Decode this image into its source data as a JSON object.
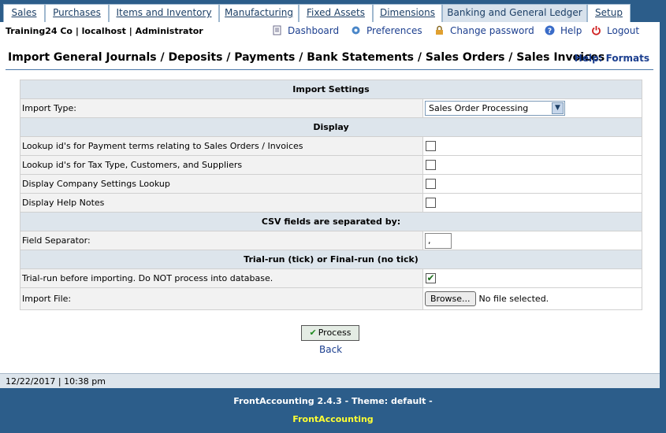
{
  "tabs": [
    {
      "label": "Sales",
      "active": false
    },
    {
      "label": "Purchases",
      "active": false
    },
    {
      "label": "Items and Inventory",
      "active": false
    },
    {
      "label": "Manufacturing",
      "active": false
    },
    {
      "label": "Fixed Assets",
      "active": false
    },
    {
      "label": "Dimensions",
      "active": false
    },
    {
      "label": "Banking and General Ledger",
      "active": true
    },
    {
      "label": "Setup",
      "active": false
    }
  ],
  "topbar": {
    "company": "Training24 Co | localhost | Administrator",
    "dashboard": "Dashboard",
    "preferences": "Preferences",
    "change_password": "Change password",
    "help": "Help",
    "logout": "Logout"
  },
  "page": {
    "title": "Import General Journals / Deposits / Payments / Bank Statements / Sales Orders / Sales Invoices",
    "help_link": "Help: Formats"
  },
  "form": {
    "import_settings_header": "Import Settings",
    "import_type_label": "Import Type:",
    "import_type_value": "Sales Order Processing",
    "display_header": "Display",
    "lookup_payment_terms": "Lookup id's for Payment terms relating to Sales Orders / Invoices",
    "lookup_tax_type": "Lookup id's for Tax Type, Customers, and Suppliers",
    "display_company_settings": "Display Company Settings Lookup",
    "display_help_notes": "Display Help Notes",
    "csv_header": "CSV fields are separated by:",
    "field_separator_label": "Field Separator:",
    "field_separator_value": ",",
    "trial_header": "Trial-run (tick) or Final-run (no tick)",
    "trial_run_label": "Trial-run before importing. Do NOT process into database.",
    "import_file_label": "Import File:",
    "browse_label": "Browse...",
    "no_file": "No file selected."
  },
  "actions": {
    "process": "Process",
    "back": "Back"
  },
  "status": {
    "datetime": "12/22/2017 | 10:38 pm"
  },
  "footer": {
    "version": "FrontAccounting 2.4.3 - Theme: default -",
    "brand": "FrontAccounting"
  },
  "colors": {
    "background": "#2c5d8a",
    "accent": "#1c3f8f",
    "footer_brand": "#ffff33"
  }
}
